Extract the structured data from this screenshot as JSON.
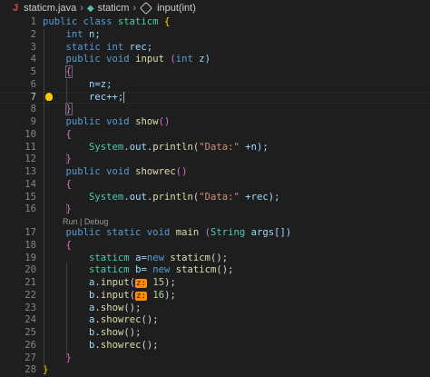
{
  "breadcrumb": {
    "file": "staticm.java",
    "class": "staticm",
    "method": "input(int)"
  },
  "codelens": "Run | Debug",
  "code": {
    "l1": {
      "num": "1",
      "kw1": "public class ",
      "cls": "staticm",
      "brace": " {"
    },
    "l2": {
      "num": "2",
      "kw": "int",
      "rest": " n;"
    },
    "l3": {
      "num": "3",
      "kw": "static int",
      "rest": " rec;"
    },
    "l4": {
      "num": "4",
      "kw": "public void",
      "fn": " input",
      "p1": " (",
      "kw2": "int",
      "rest": " z)"
    },
    "l5": {
      "num": "5",
      "brace": "{"
    },
    "l6": {
      "num": "6",
      "rest": "n=z;"
    },
    "l7": {
      "num": "7",
      "rest": "rec++;"
    },
    "l8": {
      "num": "8",
      "brace": "}"
    },
    "l9": {
      "num": "9",
      "kw": "public void",
      "fn": " show",
      "rest": "()"
    },
    "l10": {
      "num": "10",
      "brace": "{"
    },
    "l11": {
      "num": "11",
      "cls": "System",
      "rest1": ".out.",
      "fn": "println",
      "p1": "(",
      "str": "\"Data:\"",
      "rest2": " +n);"
    },
    "l12": {
      "num": "12",
      "brace": "}"
    },
    "l13": {
      "num": "13",
      "kw": "public void",
      "fn": " showrec",
      "rest": "()"
    },
    "l14": {
      "num": "14",
      "brace": "{"
    },
    "l15": {
      "num": "15",
      "cls": "System",
      "rest1": ".out.",
      "fn": "println",
      "p1": "(",
      "str": "\"Data:\"",
      "rest2": " +rec);"
    },
    "l16": {
      "num": "16",
      "brace": "}"
    },
    "l17": {
      "num": "17",
      "kw": "public static void",
      "fn": " main",
      "p1": " (",
      "cls": "String",
      "rest": " args[])"
    },
    "l18": {
      "num": "18",
      "brace": "{"
    },
    "l19": {
      "num": "19",
      "cls": "staticm",
      "rest1": " a=",
      "kw": "new",
      "fn": " staticm",
      "rest2": "();"
    },
    "l20": {
      "num": "20",
      "cls": "staticm",
      "rest1": " b= ",
      "kw": "new",
      "fn": " staticm",
      "rest2": "();"
    },
    "l21": {
      "num": "21",
      "var": "a",
      "rest1": ".",
      "fn": "input",
      "p1": "(",
      "hint": "z:",
      "num2": " 15",
      "rest2": ");"
    },
    "l22": {
      "num": "22",
      "var": "b",
      "rest1": ".",
      "fn": "input",
      "p1": "(",
      "hint": "z:",
      "num2": " 16",
      "rest2": ");"
    },
    "l23": {
      "num": "23",
      "var": "a",
      "rest1": ".",
      "fn": "show",
      "rest2": "();"
    },
    "l24": {
      "num": "24",
      "var": "a",
      "rest1": ".",
      "fn": "showrec",
      "rest2": "();"
    },
    "l25": {
      "num": "25",
      "var": "b",
      "rest1": ".",
      "fn": "show",
      "rest2": "();"
    },
    "l26": {
      "num": "26",
      "var": "b",
      "rest1": ".",
      "fn": "showrec",
      "rest2": "();"
    },
    "l27": {
      "num": "27",
      "brace": "}"
    },
    "l28": {
      "num": "28",
      "brace": "}"
    }
  }
}
